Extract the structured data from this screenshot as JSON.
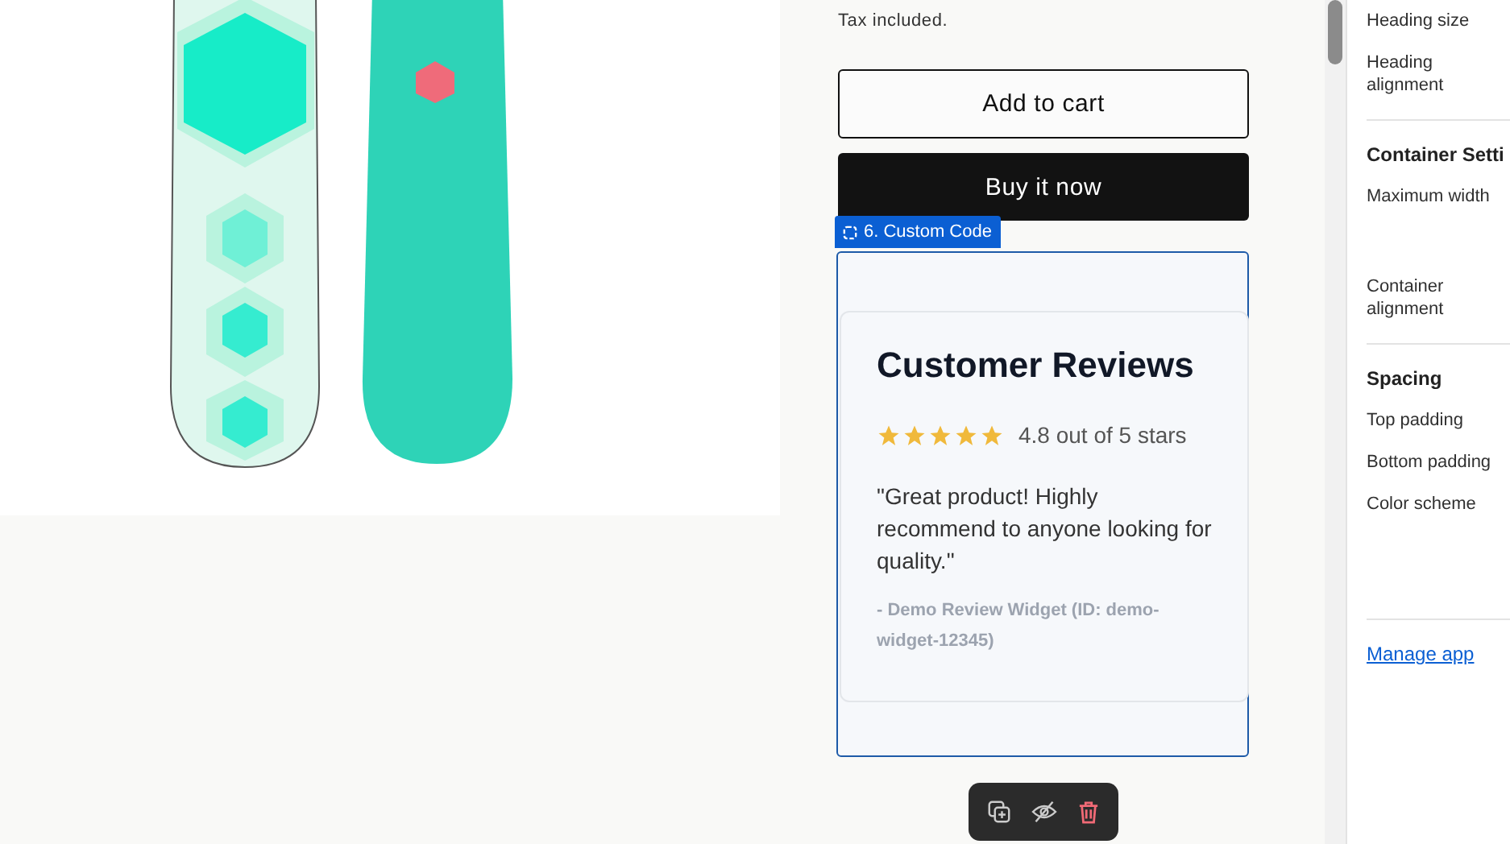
{
  "product": {
    "tax_note": "Tax included.",
    "buttons": [
      {
        "label": "Add to cart",
        "kind": "outline"
      },
      {
        "label": "Buy it now",
        "kind": "solid"
      }
    ]
  },
  "section_tag": {
    "label": "6. Custom Code"
  },
  "review_widget": {
    "title": "Customer Reviews",
    "stars": 5,
    "rating": "4.8 out of 5 stars",
    "quote": "\"Great product! Highly recommend to anyone looking for quality.\"",
    "source": "- Demo Review Widget (ID: demo-widget-12345)"
  },
  "sidebar": {
    "items": [
      {
        "label": "Heading size",
        "kind": "setting"
      },
      {
        "label": "Heading alignment",
        "kind": "setting"
      },
      {
        "label": "Container Setti",
        "kind": "heading"
      },
      {
        "label": "Maximum width",
        "kind": "setting",
        "tall": true
      },
      {
        "label": "Container alignment",
        "kind": "setting"
      },
      {
        "label": "Spacing",
        "kind": "heading"
      },
      {
        "label": "Top padding",
        "kind": "setting"
      },
      {
        "label": "Bottom padding",
        "kind": "setting"
      },
      {
        "label": "Color scheme",
        "kind": "setting",
        "tall": true
      }
    ],
    "link": "Manage app"
  }
}
